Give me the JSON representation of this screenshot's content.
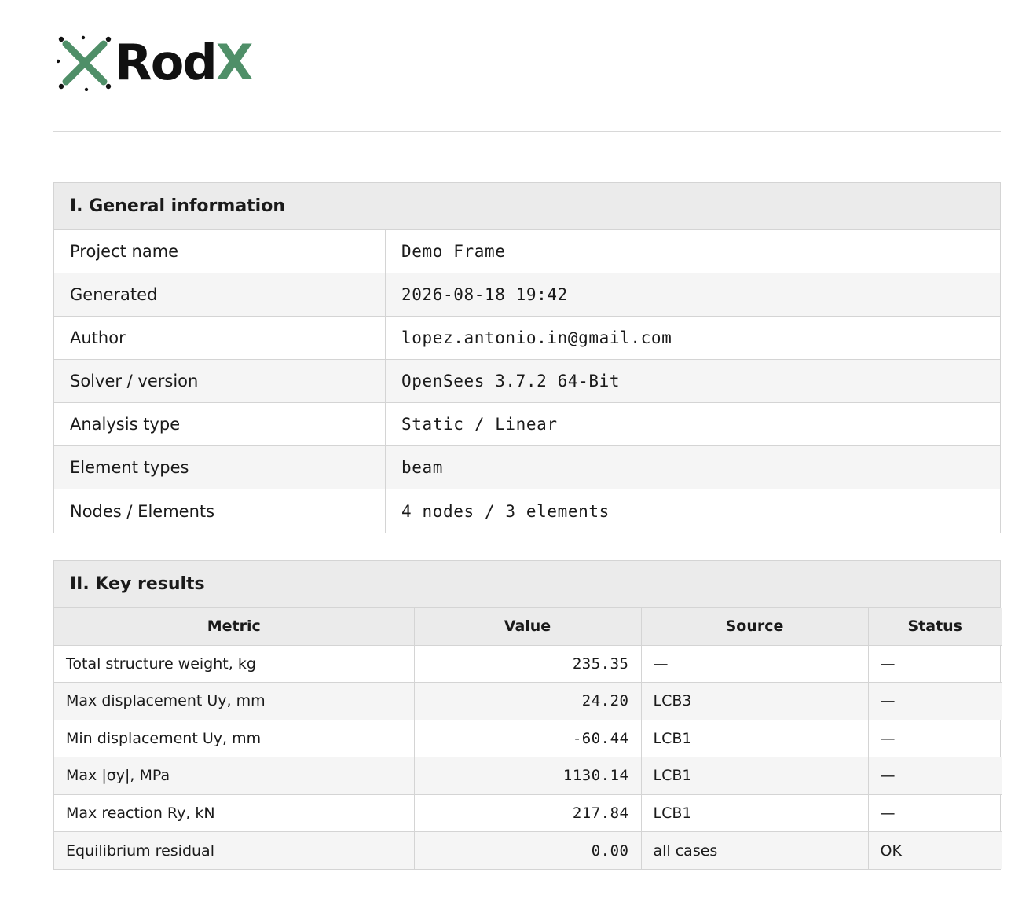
{
  "brand": {
    "logo_icon": "x-nodes-logo-icon",
    "name_part1": "Rod",
    "name_part2": "X",
    "accent_color": "#4f8f68"
  },
  "general": {
    "title": "I. General information",
    "rows": [
      {
        "label": "Project name",
        "value": "Demo Frame"
      },
      {
        "label": "Generated",
        "value": "2026-08-18 19:42"
      },
      {
        "label": "Author",
        "value": "lopez.antonio.in@gmail.com"
      },
      {
        "label": "Solver / version",
        "value": "OpenSees 3.7.2 64-Bit"
      },
      {
        "label": "Analysis type",
        "value": "Static / Linear"
      },
      {
        "label": "Element types",
        "value": "beam"
      },
      {
        "label": "Nodes / Elements",
        "value": "4 nodes / 3 elements"
      }
    ]
  },
  "results": {
    "title": "II. Key results",
    "columns": [
      "Metric",
      "Value",
      "Source",
      "Status"
    ],
    "rows": [
      {
        "metric": "Total structure weight, kg",
        "value": "235.35",
        "source": "—",
        "status": "—"
      },
      {
        "metric": "Max displacement Uy, mm",
        "value": "24.20",
        "source": "LCB3",
        "status": "—"
      },
      {
        "metric": "Min displacement Uy, mm",
        "value": "-60.44",
        "source": "LCB1",
        "status": "—"
      },
      {
        "metric": "Max |σy|, MPa",
        "value": "1130.14",
        "source": "LCB1",
        "status": "—"
      },
      {
        "metric": "Max reaction Ry, kN",
        "value": "217.84",
        "source": "LCB1",
        "status": "—"
      },
      {
        "metric": "Equilibrium residual",
        "value": "0.00",
        "source": "all cases",
        "status": "OK"
      }
    ]
  }
}
